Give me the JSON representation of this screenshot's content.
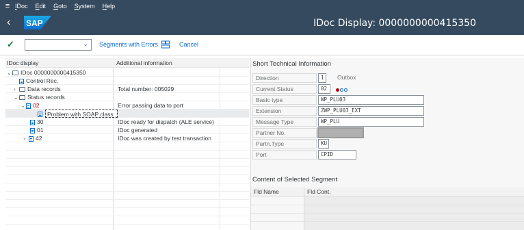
{
  "menubar": {
    "items": [
      "IDoc",
      "Edit",
      "Goto",
      "System",
      "Help"
    ]
  },
  "titlebar": {
    "title": "IDoc Display: 0000000000415350",
    "logo_text": "SAP"
  },
  "toolbar": {
    "segments_with_errors": "Segments with Errors",
    "cancel": "Cancel",
    "command_value": ""
  },
  "tree": {
    "headers": [
      "IDoc display",
      "Additional information"
    ],
    "rows": [
      {
        "label": "IDoc 0000000000415350",
        "info": ""
      },
      {
        "label": "Control Rec.",
        "info": ""
      },
      {
        "label": "Data records",
        "info": "Total number: 005029"
      },
      {
        "label": "Status records",
        "info": ""
      },
      {
        "label": "02",
        "info": "Error passing data to port"
      },
      {
        "label": "Problem with SOAP class",
        "info": ""
      },
      {
        "label": "30",
        "info": "IDoc ready for dispatch (ALE service)"
      },
      {
        "label": "01",
        "info": "IDoc generated"
      },
      {
        "label": "42",
        "info": "IDoc was created by test transaction"
      }
    ]
  },
  "tech_info": {
    "title": "Short Technical Information",
    "direction_label": "Direction",
    "direction_value": "1",
    "direction_text": "Outbox",
    "status_label": "Current Status",
    "status_value": "02",
    "basic_type_label": "Basic type",
    "basic_type_value": "WP_PLU03",
    "extension_label": "Extension",
    "extension_value": "ZWP_PLU03_EXT",
    "message_type_label": "Message Type",
    "message_type_value": "WP_PLU",
    "partner_no_label": "Partner No.",
    "partner_no_value": "",
    "partn_type_label": "Partn.Type",
    "partn_type_value": "KU",
    "port_label": "Port",
    "port_value": "CPID"
  },
  "segment": {
    "title": "Content of Selected Segment",
    "col_name": "Fld Name",
    "col_cont": "Fld Cont."
  },
  "colors": {
    "shell": "#354a5f",
    "accent": "#0a6ed1",
    "error": "#bb0000",
    "highlight": "#e04b33"
  }
}
